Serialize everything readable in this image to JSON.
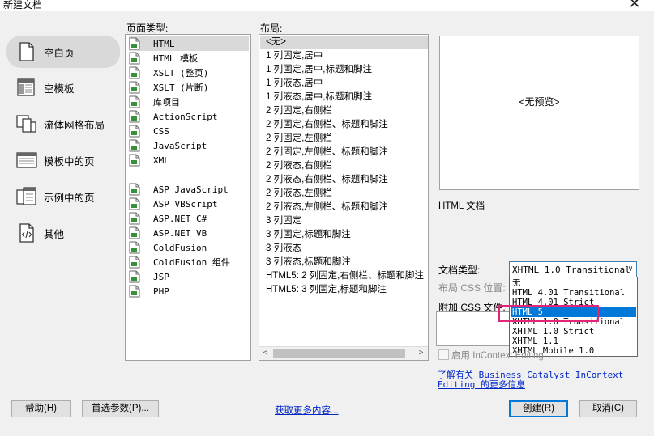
{
  "window": {
    "title": "新建文档",
    "close_glyph": "✕"
  },
  "categories": [
    {
      "label": "空白页",
      "icon": "blank-page-icon",
      "selected": true
    },
    {
      "label": "空模板",
      "icon": "blank-template-icon",
      "selected": false
    },
    {
      "label": "流体网格布局",
      "icon": "fluid-grid-icon",
      "selected": false
    },
    {
      "label": "模板中的页",
      "icon": "template-page-icon",
      "selected": false
    },
    {
      "label": "示例中的页",
      "icon": "sample-page-icon",
      "selected": false
    },
    {
      "label": "其他",
      "icon": "other-code-icon",
      "selected": false
    }
  ],
  "page_type": {
    "label": "页面类型:",
    "items": [
      {
        "label": "HTML",
        "selected": true
      },
      {
        "label": "HTML 模板"
      },
      {
        "label": "XSLT (整页)"
      },
      {
        "label": "XSLT (片断)"
      },
      {
        "label": "库项目"
      },
      {
        "label": "ActionScript"
      },
      {
        "label": "CSS"
      },
      {
        "label": "JavaScript"
      },
      {
        "label": "XML"
      },
      {
        "label": "ASP JavaScript"
      },
      {
        "label": "ASP VBScript"
      },
      {
        "label": "ASP.NET C#"
      },
      {
        "label": "ASP.NET VB"
      },
      {
        "label": "ColdFusion"
      },
      {
        "label": "ColdFusion 组件"
      },
      {
        "label": "JSP"
      },
      {
        "label": "PHP"
      }
    ]
  },
  "layout": {
    "label": "布局:",
    "items": [
      {
        "label": "<无>",
        "selected": true
      },
      {
        "label": "1 列固定,居中"
      },
      {
        "label": "1 列固定,居中,标题和脚注"
      },
      {
        "label": "1 列液态,居中"
      },
      {
        "label": "1 列液态,居中,标题和脚注"
      },
      {
        "label": "2 列固定,右侧栏"
      },
      {
        "label": "2 列固定,右侧栏、标题和脚注"
      },
      {
        "label": "2 列固定,左侧栏"
      },
      {
        "label": "2 列固定,左侧栏、标题和脚注"
      },
      {
        "label": "2 列液态,右侧栏"
      },
      {
        "label": "2 列液态,右侧栏、标题和脚注"
      },
      {
        "label": "2 列液态,左侧栏"
      },
      {
        "label": "2 列液态,左侧栏、标题和脚注"
      },
      {
        "label": "3 列固定"
      },
      {
        "label": "3 列固定,标题和脚注"
      },
      {
        "label": "3 列液态"
      },
      {
        "label": "3 列液态,标题和脚注"
      },
      {
        "label": "HTML5: 2 列固定,右侧栏、标题和脚注"
      },
      {
        "label": "HTML5: 3 列固定,标题和脚注"
      }
    ],
    "scroll_left": "<",
    "scroll_right": ">"
  },
  "preview": {
    "text": "<无预览>",
    "description": "HTML 文档"
  },
  "doctype": {
    "label": "文档类型:",
    "selected": "XHTML 1.0 Transitional",
    "options": [
      {
        "label": "无"
      },
      {
        "label": "HTML 4.01 Transitional"
      },
      {
        "label": "HTML 4.01 Strict"
      },
      {
        "label": "HTML 5",
        "highlighted": true
      },
      {
        "label": "XHTML 1.0 Transitional"
      },
      {
        "label": "XHTML 1.0 Strict"
      },
      {
        "label": "XHTML 1.1"
      },
      {
        "label": "XHTML Mobile 1.0"
      }
    ]
  },
  "layout_css": {
    "label": "布局 CSS 位置:"
  },
  "attach_css": {
    "label": "附加 CSS 文件:"
  },
  "incontext": {
    "label": "启用 InContext Editing",
    "checked": false
  },
  "learn_more_link": {
    "line1": "了解有关 Business Catalyst InContext",
    "line2": "Editing 的更多信息"
  },
  "buttons": {
    "help": "帮助(H)",
    "preferences": "首选参数(P)...",
    "get_more": "获取更多内容...",
    "create": "创建(R)",
    "cancel": "取消(C)"
  },
  "colors": {
    "accent": "#0078d7",
    "highlight_box": "#e0257a",
    "link": "#0026c8"
  }
}
